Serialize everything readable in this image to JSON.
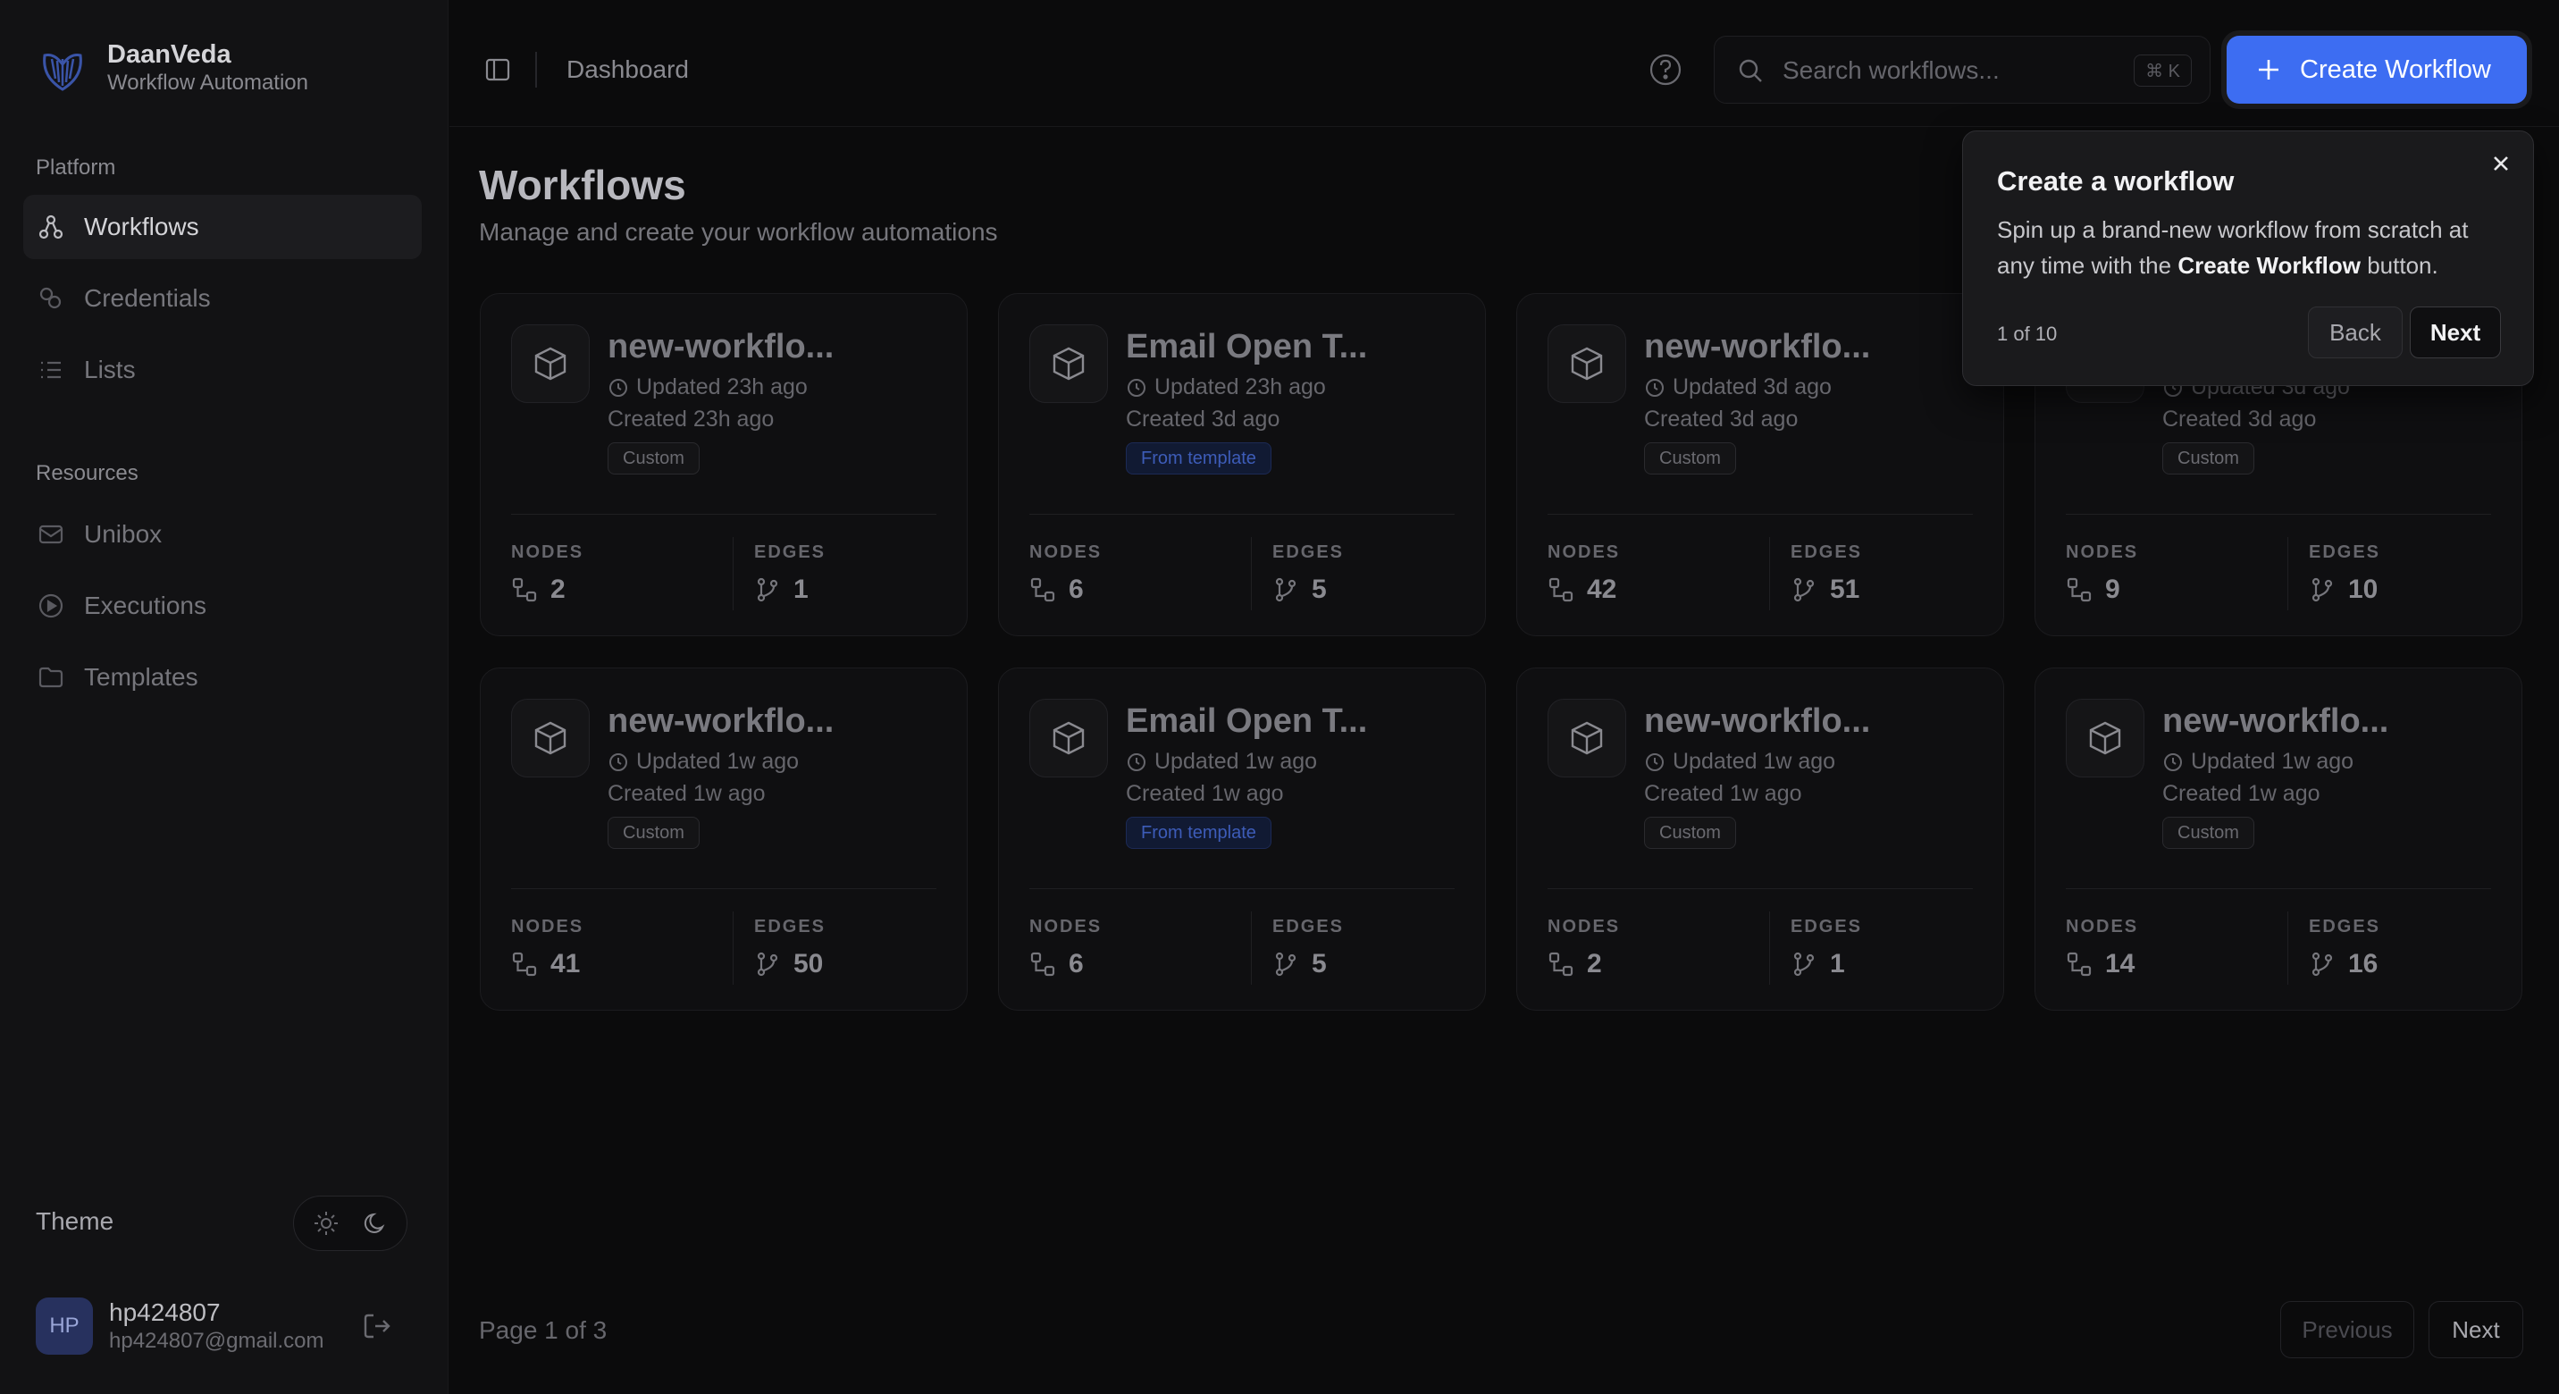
{
  "brand": {
    "name": "DaanVeda",
    "subtitle": "Workflow Automation"
  },
  "sidebar": {
    "platform_label": "Platform",
    "platform_items": [
      {
        "label": "Workflows",
        "icon": "workflow-icon",
        "active": true
      },
      {
        "label": "Credentials",
        "icon": "credentials-icon"
      },
      {
        "label": "Lists",
        "icon": "list-icon"
      }
    ],
    "resources_label": "Resources",
    "resources_items": [
      {
        "label": "Unibox",
        "icon": "mail-icon"
      },
      {
        "label": "Executions",
        "icon": "play-circle-icon"
      },
      {
        "label": "Templates",
        "icon": "folder-icon"
      }
    ],
    "theme_label": "Theme"
  },
  "user": {
    "initials": "HP",
    "name": "hp424807",
    "email": "hp424807@gmail.com"
  },
  "header": {
    "breadcrumb": "Dashboard",
    "search_placeholder": "Search workflows...",
    "search_shortcut": "⌘ K",
    "create_label": "Create Workflow"
  },
  "main": {
    "title": "Workflows",
    "subtitle": "Manage and create your workflow automations",
    "nodes_label": "NODES",
    "edges_label": "EDGES",
    "cards": [
      {
        "title": "new-workflo...",
        "updated": "Updated 23h ago",
        "created": "Created 23h ago",
        "tag": "Custom",
        "nodes": "2",
        "edges": "1"
      },
      {
        "title": "Email Open T...",
        "updated": "Updated 23h ago",
        "created": "Created 3d ago",
        "tag": "From template",
        "nodes": "6",
        "edges": "5"
      },
      {
        "title": "new-workflo...",
        "updated": "Updated 3d ago",
        "created": "Created 3d ago",
        "tag": "Custom",
        "nodes": "42",
        "edges": "51"
      },
      {
        "title": "",
        "updated": "Updated 3d ago",
        "created": "Created 3d ago",
        "tag": "Custom",
        "nodes": "9",
        "edges": "10"
      },
      {
        "title": "new-workflo...",
        "updated": "Updated 1w ago",
        "created": "Created 1w ago",
        "tag": "Custom",
        "nodes": "41",
        "edges": "50"
      },
      {
        "title": "Email Open T...",
        "updated": "Updated 1w ago",
        "created": "Created 1w ago",
        "tag": "From template",
        "nodes": "6",
        "edges": "5"
      },
      {
        "title": "new-workflo...",
        "updated": "Updated 1w ago",
        "created": "Created 1w ago",
        "tag": "Custom",
        "nodes": "2",
        "edges": "1"
      },
      {
        "title": "new-workflo...",
        "updated": "Updated 1w ago",
        "created": "Created 1w ago",
        "tag": "Custom",
        "nodes": "14",
        "edges": "16"
      }
    ],
    "pagination": {
      "text": "Page 1 of 3",
      "previous": "Previous",
      "next": "Next"
    }
  },
  "popover": {
    "title": "Create a workflow",
    "body_prefix": "Spin up a brand-new workflow from scratch at any time with the ",
    "body_bold": "Create Workflow",
    "body_suffix": " button.",
    "step": "1 of 10",
    "back": "Back",
    "next": "Next"
  },
  "colors": {
    "accent": "#3d6df2",
    "background": "#0b0b0c",
    "sidebar": "#121214"
  }
}
